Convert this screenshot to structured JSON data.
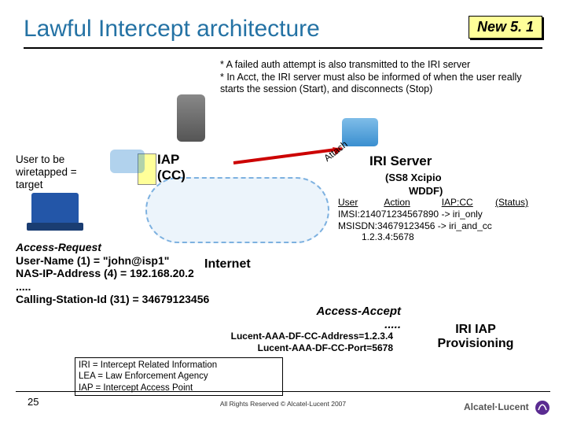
{
  "title": "Lawful Intercept architecture",
  "badge": "New 5. 1",
  "notes_line1": "* A failed auth attempt is also transmitted to the IRI server",
  "notes_line2": "* In Acct, the IRI server must also be informed of when the user really starts the session (Start), and disconnects (Stop)",
  "user_label": "User to be wiretapped = target",
  "iap_cc_1": "IAP",
  "iap_cc_2": "(CC)",
  "attach_label": "Attach",
  "iri_server": "IRI Server",
  "iri_sub": "(SS8 Xcipio",
  "wddf_sub": "WDDF)",
  "tbl": {
    "h_user": "User",
    "h_action": "Action",
    "h_iap": "IAP:CC",
    "h_status": "(Status)",
    "r1": "IMSI:214071234567890 -> iri_only",
    "r2a": "MSISDN:34679123456 -> iri_and_cc",
    "r2b": "1.2.3.4:5678"
  },
  "access_req": {
    "title": "Access-Request",
    "l1": "User-Name (1) = \"john@isp1\"",
    "l2": "NAS-IP-Address (4) = 192.168.20.2",
    "dots": ".....",
    "l3": "Calling-Station-Id (31) = 34679123456"
  },
  "internet": "Internet",
  "access_accept": {
    "title": "Access-Accept",
    "dots": "....."
  },
  "lucent": {
    "l1": "Lucent-AAA-DF-CC-Address=1.2.3.4",
    "l2": "Lucent-AAA-DF-CC-Port=5678"
  },
  "iri_iap_prov": "IRI IAP Provisioning",
  "defs": {
    "l1": "IRI = Intercept Related Information",
    "l2": "LEA = Law Enforcement Agency",
    "l3": "IAP = Intercept Access Point"
  },
  "page_num": "25",
  "copyright": "All Rights Reserved © Alcatel-Lucent 2007",
  "brand": "Alcatel·Lucent"
}
